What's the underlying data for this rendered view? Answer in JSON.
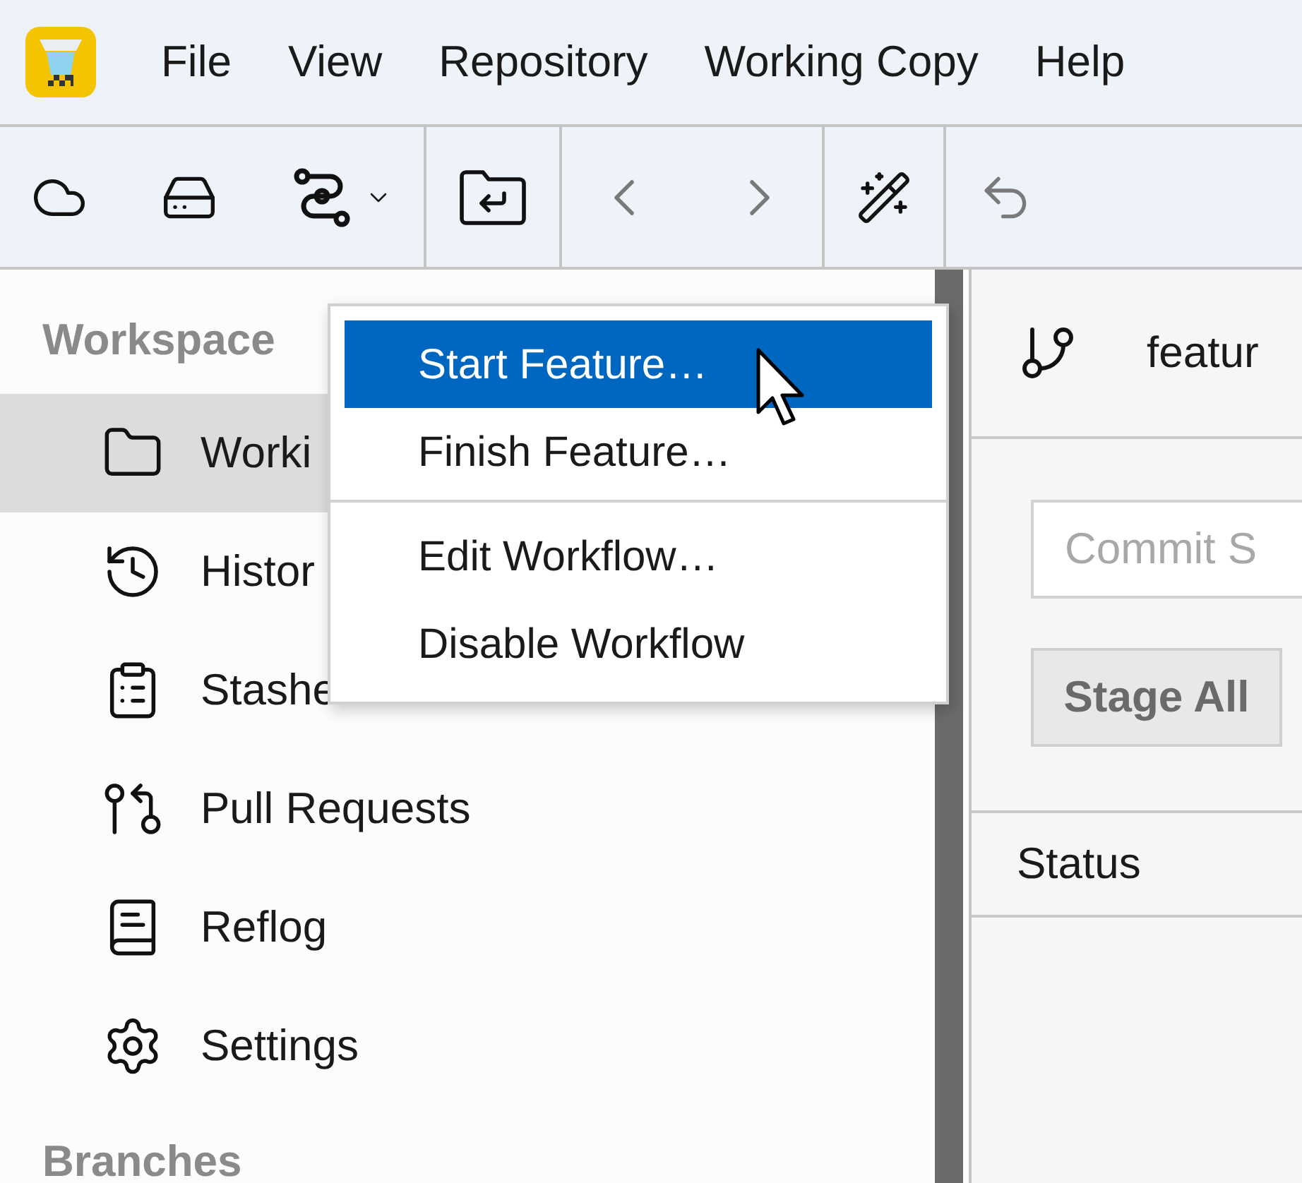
{
  "menubar": {
    "items": [
      "File",
      "View",
      "Repository",
      "Working Copy",
      "Help"
    ]
  },
  "toolbar": {
    "groups": [
      [
        {
          "kind": "cloud",
          "disabled": false
        },
        {
          "kind": "drive",
          "disabled": false
        },
        {
          "kind": "workflow",
          "disabled": false
        }
      ],
      [
        {
          "kind": "folder-return",
          "disabled": false
        }
      ],
      [
        {
          "kind": "back",
          "disabled": true
        },
        {
          "kind": "forward",
          "disabled": true
        }
      ],
      [
        {
          "kind": "wand",
          "disabled": false
        }
      ],
      [
        {
          "kind": "undo",
          "disabled": true
        }
      ]
    ]
  },
  "sidebar": {
    "heading": "Workspace",
    "items": [
      {
        "label": "Worki",
        "kind": "folder",
        "selected": true
      },
      {
        "label": "Histor",
        "kind": "history",
        "selected": false
      },
      {
        "label": "Stashe",
        "kind": "clipboard",
        "selected": false
      },
      {
        "label": "Pull Requests",
        "kind": "pull-request",
        "selected": false
      },
      {
        "label": "Reflog",
        "kind": "book",
        "selected": false
      },
      {
        "label": "Settings",
        "kind": "settings",
        "selected": false
      }
    ],
    "section_heading": "Branches"
  },
  "context_menu": {
    "groups": [
      [
        {
          "label": "Start Feature…",
          "selected": true
        },
        {
          "label": "Finish Feature…",
          "selected": false
        }
      ],
      [
        {
          "label": "Edit Workflow…",
          "selected": false
        },
        {
          "label": "Disable Workflow",
          "selected": false
        }
      ]
    ]
  },
  "detail": {
    "branch": "featur",
    "commit_field": {
      "placeholder": "Commit S"
    },
    "stage_button": "Stage All",
    "status_header": "Status"
  }
}
